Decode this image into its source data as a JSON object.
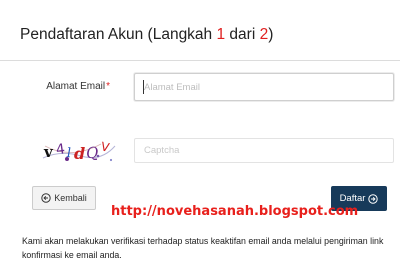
{
  "header": {
    "title_prefix": "Pendaftaran Akun  (Langkah ",
    "step_current": "1",
    "title_middle": " dari ",
    "step_total": "2",
    "title_suffix": ")"
  },
  "form": {
    "email": {
      "label": "Alamat Email",
      "required_mark": "*",
      "placeholder": "Alamat Email",
      "value": ""
    },
    "captcha": {
      "image_chars": [
        "v",
        "4",
        "l",
        "d",
        "Q",
        "V"
      ],
      "placeholder": "Captcha",
      "value": ""
    }
  },
  "actions": {
    "back_label": "Kembali",
    "back_icon": "arrow-left-circle-icon",
    "submit_label": "Daftar",
    "submit_icon": "arrow-right-circle-icon"
  },
  "watermark": "http://novehasanah.blogspot.com",
  "info_text": "Kami akan melakukan verifikasi terhadap status keaktifan email anda melalui pengiriman link konfirmasi ke email anda.",
  "colors": {
    "accent_red": "#e02020",
    "submit_bg": "#173a5a",
    "watermark": "#e8201c"
  }
}
